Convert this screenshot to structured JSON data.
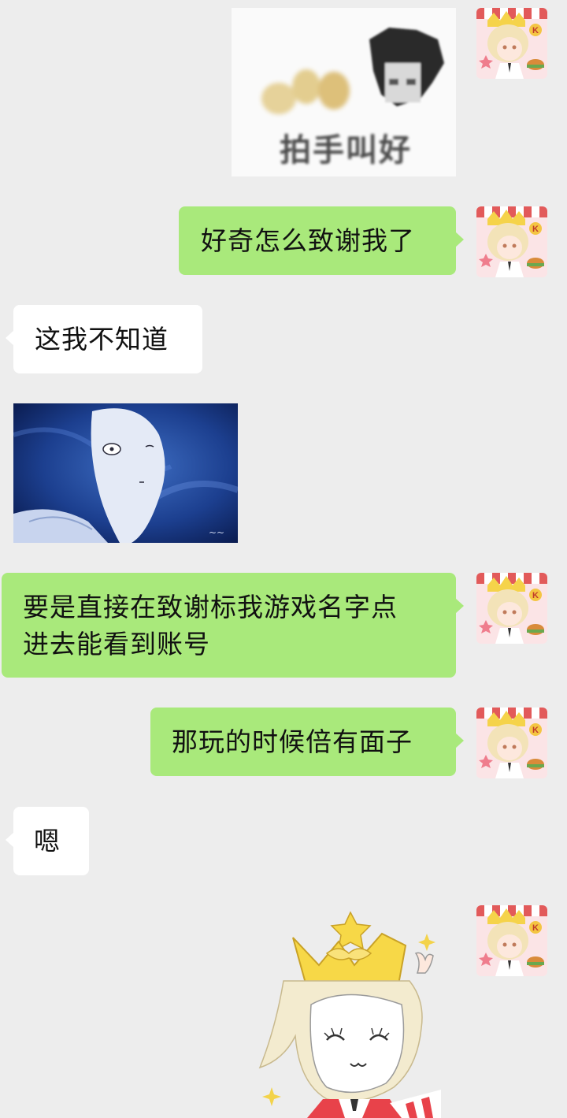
{
  "messages": [
    {
      "type": "image",
      "from": "me",
      "caption": "拍手叫好"
    },
    {
      "type": "text",
      "from": "me",
      "text": "好奇怎么致谢我了"
    },
    {
      "type": "text",
      "from": "other",
      "text": "这我不知道"
    },
    {
      "type": "image",
      "from": "other",
      "desc": "anime-meme"
    },
    {
      "type": "text",
      "from": "me",
      "lines": [
        "要是直接在致谢标我游戏名字点",
        "进去能看到账号"
      ]
    },
    {
      "type": "text",
      "from": "me",
      "text": "那玩的时候倍有面子"
    },
    {
      "type": "text",
      "from": "other",
      "text": "嗯"
    },
    {
      "type": "sticker",
      "from": "me"
    }
  ],
  "avatar": {
    "badge": "K"
  },
  "colors": {
    "background": "#ededed",
    "outgoing_bubble": "#a9e97b",
    "incoming_bubble": "#ffffff"
  }
}
